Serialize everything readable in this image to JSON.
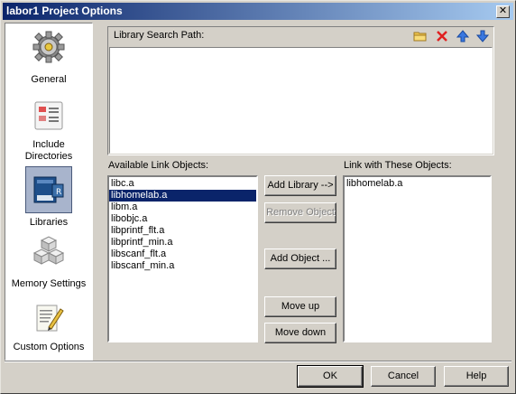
{
  "window": {
    "title": "labor1 Project Options",
    "close_label": "✕"
  },
  "sidebar": {
    "items": [
      {
        "label": "General",
        "icon": "gear-icon"
      },
      {
        "label": "Include\nDirectories",
        "icon": "directories-icon"
      },
      {
        "label": "Libraries",
        "icon": "libraries-icon",
        "selected": true
      },
      {
        "label": "Memory Settings",
        "icon": "memory-blocks-icon"
      },
      {
        "label": "Custom Options",
        "icon": "custom-options-icon"
      }
    ]
  },
  "search_path": {
    "label": "Library Search Path:",
    "tools": [
      "folder-icon",
      "delete-icon",
      "arrow-up-icon",
      "arrow-down-icon"
    ],
    "items": []
  },
  "available": {
    "label": "Available Link Objects:",
    "items": [
      "libc.a",
      "libhomelab.a",
      "libm.a",
      "libobjc.a",
      "libprintf_flt.a",
      "libprintf_min.a",
      "libscanf_flt.a",
      "libscanf_min.a"
    ],
    "selected_index": 1
  },
  "linked": {
    "label": "Link with These Objects:",
    "items": [
      "libhomelab.a"
    ]
  },
  "buttons": {
    "add_library": "Add Library -->",
    "remove_object": "Remove Object",
    "add_object": "Add Object ...",
    "move_up": "Move up",
    "move_down": "Move down"
  },
  "footer": {
    "ok": "OK",
    "cancel": "Cancel",
    "help": "Help"
  }
}
